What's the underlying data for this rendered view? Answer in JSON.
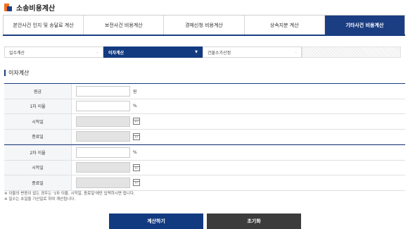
{
  "header": {
    "title": "소송비용계산"
  },
  "tabs": [
    {
      "label": "본안사건 인지 및 송달료 계산",
      "active": false
    },
    {
      "label": "보전사건 비용계산",
      "active": false
    },
    {
      "label": "경매신청 비용계산",
      "active": false
    },
    {
      "label": "상속지분 계산",
      "active": false
    },
    {
      "label": "기타사건 비용계산",
      "active": true
    }
  ],
  "subtabs": [
    {
      "label": "일수계산",
      "active": false
    },
    {
      "label": "이자계산",
      "active": true
    },
    {
      "label": "건물소가산정",
      "active": false
    }
  ],
  "section": {
    "title": "이자계산"
  },
  "form1": {
    "principal_label": "원금",
    "principal_unit": "원",
    "rate1_label": "1차 이율",
    "rate_unit": "%",
    "start_label": "시작일",
    "end_label": "종료일"
  },
  "form2": {
    "rate2_label": "2차 이율",
    "rate_unit": "%",
    "start_label": "시작일",
    "end_label": "종료일"
  },
  "notes": [
    "※ 이율의 변동이 없는 경우는 '1차 이율, 시작일, 종료일'에만 입력하시면 됩니다.",
    "※ 일수는 초일을 기산일로 하여 계산됩니다."
  ],
  "buttons": {
    "calculate": "계산하기",
    "reset": "초기화"
  },
  "colors": {
    "accent": "#1b3d82",
    "dark_button": "#3c3c3c",
    "logo_orange": "#f07020"
  }
}
